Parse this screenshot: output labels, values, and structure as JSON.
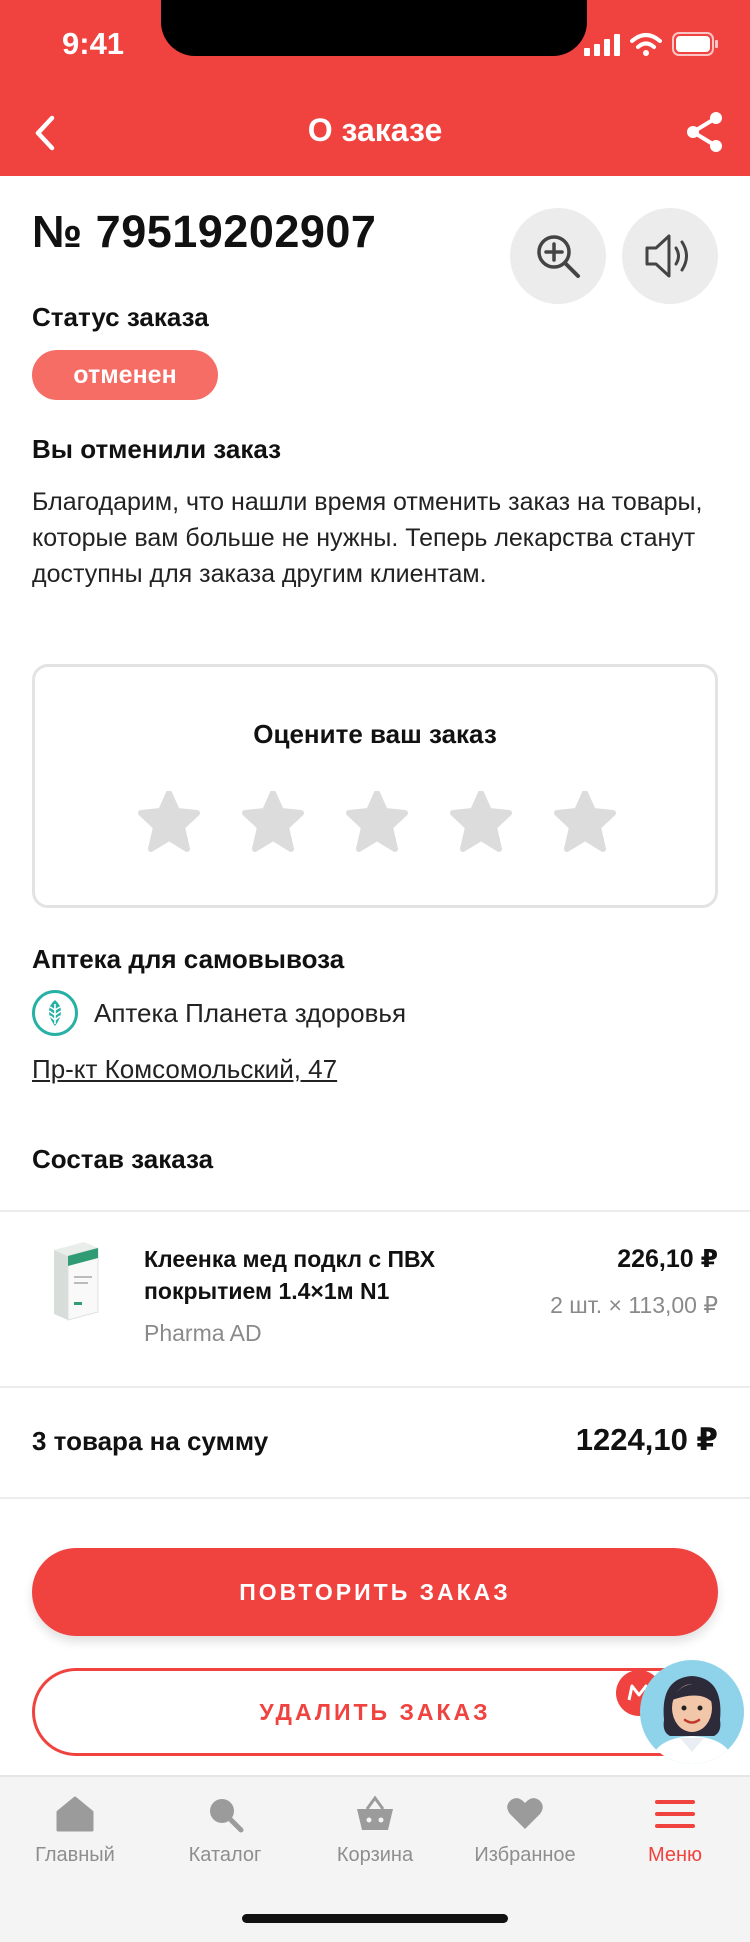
{
  "status_bar": {
    "time": "9:41"
  },
  "header": {
    "title": "О заказе"
  },
  "order": {
    "number": "№ 79519202907",
    "status_label": "Статус заказа",
    "status_badge": "отменен",
    "cancel_title": "Вы отменили заказ",
    "cancel_text": "Благодарим, что нашли время отменить заказ на товары, которые вам больше не нужны. Теперь лекарства станут доступны для заказа другим клиентам."
  },
  "rating": {
    "title": "Оцените ваш заказ",
    "value": 0,
    "max": 5
  },
  "pickup": {
    "title": "Аптека для самовывоза",
    "pharmacy_name": "Аптека Планета здоровья",
    "address": "Пр-кт Комсомольский, 47"
  },
  "composition": {
    "title": "Состав заказа",
    "items": [
      {
        "name": "Клеенка мед подкл с ПВХ покрытием 1.4×1м N1",
        "brand": "Pharma AD",
        "price": "226,10 ₽",
        "qty": "2 шт. × 113,00 ₽"
      }
    ]
  },
  "summary": {
    "label": "3 товара на сумму",
    "total": "1224,10 ₽"
  },
  "actions": {
    "repeat": "ПОВТОРИТЬ ЗАКАЗ",
    "delete": "УДАЛИТЬ ЗАКАЗ"
  },
  "tabbar": {
    "items": [
      {
        "label": "Главный",
        "icon": "home-icon"
      },
      {
        "label": "Каталог",
        "icon": "search-icon"
      },
      {
        "label": "Корзина",
        "icon": "basket-icon"
      },
      {
        "label": "Избранное",
        "icon": "heart-icon"
      },
      {
        "label": "Меню",
        "icon": "menu-icon"
      }
    ],
    "active_index": 4
  },
  "colors": {
    "accent": "#f0423f",
    "badge": "#f56d65",
    "star_empty": "#dcdcdc",
    "pharmacy_brand": "#27b1a5"
  }
}
